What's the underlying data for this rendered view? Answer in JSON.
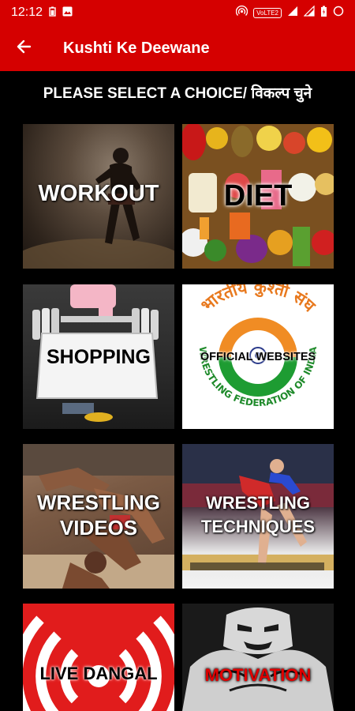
{
  "status_bar": {
    "time": "12:12",
    "network_badge": "VoLTE2"
  },
  "app_bar": {
    "title": "Kushti Ke Deewane"
  },
  "heading": "PLEASE SELECT A CHOICE/ विकल्प चुने",
  "tiles": [
    {
      "label": "WORKOUT"
    },
    {
      "label": "DIET"
    },
    {
      "label": "SHOPPING"
    },
    {
      "label": "OFFICIAL WEBSITES",
      "arc_text": "भारतीय कुश्ती संघ",
      "ring_text": "WRESTLING FEDERATION OF INDIA"
    },
    {
      "label_line1": "WRESTLING",
      "label_line2": "VIDEOS"
    },
    {
      "label_line1": "WRESTLING",
      "label_line2": "TECHNIQUES"
    },
    {
      "label": "LIVE DANGAL"
    },
    {
      "label": "MOTIVATION"
    }
  ],
  "colors": {
    "primary": "#d50000",
    "background": "#000000",
    "motivation_text": "#e00000"
  }
}
